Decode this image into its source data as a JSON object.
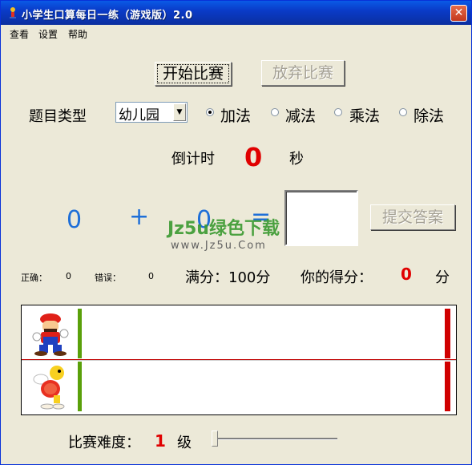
{
  "window": {
    "title": "小学生口算每日一练（游戏版）2.0",
    "close_glyph": "✕"
  },
  "menu": [
    "查看",
    "设置",
    "帮助"
  ],
  "buttons": {
    "start": "开始比赛",
    "abandon": "放弃比赛",
    "submit": "提交答案"
  },
  "question_type": {
    "label": "题目类型",
    "selected": "幼儿园",
    "options": [
      "加法",
      "减法",
      "乘法",
      "除法"
    ],
    "checked": "加法"
  },
  "timer": {
    "label": "倒计时",
    "value": "0",
    "unit": "秒"
  },
  "equation": {
    "left": "0",
    "op": "+",
    "right": "0",
    "eq": "=",
    "answer": ""
  },
  "watermark": {
    "brand": "Jz5u绿色下载",
    "url": "www.Jz5u.Com"
  },
  "stats": {
    "correct_label": "正确：",
    "correct_value": "0",
    "wrong_label": "错误：",
    "wrong_value": "0",
    "full_score": "满分：100分",
    "your_score_label": "你的得分：",
    "your_score_value": "0",
    "score_unit": "分"
  },
  "difficulty": {
    "label": "比赛难度：",
    "value": "1",
    "unit": "级",
    "slider_level": 0
  },
  "colors": {
    "accent_red": "#e00000",
    "number_blue": "#1e6fd8",
    "start_green": "#5aa00a"
  },
  "racers": [
    "mario-icon",
    "koopa-paratroopa-icon"
  ]
}
